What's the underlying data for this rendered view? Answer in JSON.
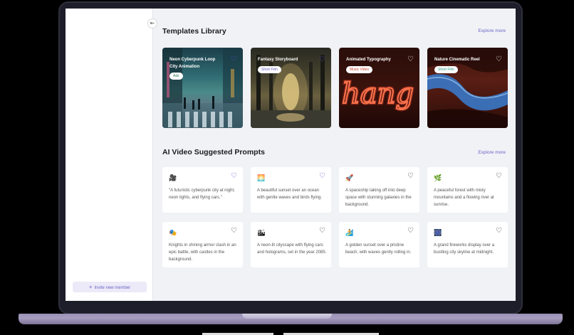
{
  "sidebar": {
    "collapse_icon": "collapse-sidebar-icon",
    "invite_label": "Invite new member"
  },
  "templates": {
    "title": "Templates Library",
    "explore": "Explore more",
    "cards": [
      {
        "title": "Neon Cyberpunk Loop City Animation",
        "tag": "Ads",
        "tag_color": "#2e7a5a",
        "liked": true
      },
      {
        "title": "Fantasy Storyboard",
        "tag": "Short Film",
        "tag_color": "#6b63c6",
        "liked": true
      },
      {
        "title": "Animated Typography",
        "tag": "Music Video",
        "tag_color": "#d0462f",
        "liked": false
      },
      {
        "title": "Nature Cinematic Reel",
        "tag": "Short Film",
        "tag_color": "#2e9a7a",
        "liked": false
      }
    ]
  },
  "prompts": {
    "title": "AI Video Suggested Prompts",
    "explore": "Explore more",
    "items": [
      {
        "icon": "movie-camera-icon",
        "glyph": "🎥",
        "text": "\"A futuristic cyberpunk city at night, neon lights, and flying cars.\"",
        "liked": true
      },
      {
        "icon": "sunset-icon",
        "glyph": "🌅",
        "text": "A beautiful sunset over an ocean with gentle waves and birds flying.",
        "liked": true
      },
      {
        "icon": "rocket-icon",
        "glyph": "🚀",
        "text": "A spaceship taking off into deep space with stunning galaxies in the background.",
        "liked": false
      },
      {
        "icon": "plant-icon",
        "glyph": "🌿",
        "text": "A peaceful forest with misty mountains and a flowing river at sunrise.",
        "liked": false
      },
      {
        "icon": "theater-masks-icon",
        "glyph": "🎭",
        "text": "Knights in shining armor clash in an epic battle, with castles in the background.",
        "liked": false
      },
      {
        "icon": "cityscape-icon",
        "glyph": "🏙",
        "text": "A neon-lit cityscape with flying cars and holograms, set in the year 2085.",
        "liked": false
      },
      {
        "icon": "surfer-icon",
        "glyph": "🏄",
        "text": "A golden sunset over a pristine beach, with waves gently rolling in.",
        "liked": false
      },
      {
        "icon": "fireworks-icon",
        "glyph": "🎆",
        "text": "A grand fireworks display over a bustling city skyline at midnight.",
        "liked": false
      }
    ]
  },
  "colors": {
    "accent": "#6b63c6",
    "liked_heart": "#5a4fd0",
    "background": "#f1f2f6"
  }
}
